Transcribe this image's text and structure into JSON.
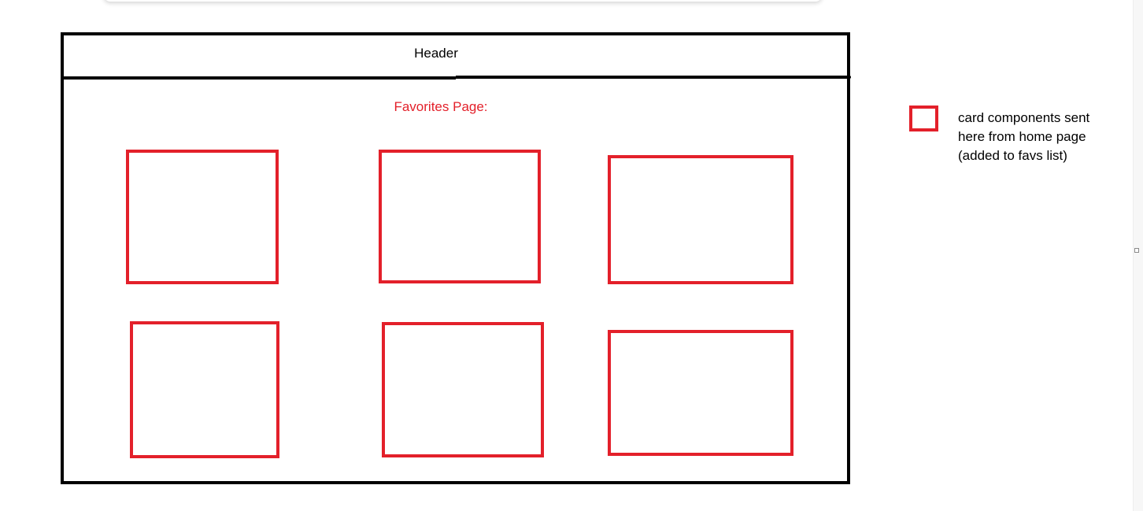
{
  "wireframe": {
    "header_label": "Header",
    "page_label": "Favorites Page:",
    "card_count": 6
  },
  "legend": {
    "lines": [
      "card components sent",
      "here from home page",
      "(added to favs list)"
    ]
  },
  "colors": {
    "outline": "#000000",
    "card_outline": "#e3202a",
    "page_label_text": "#e3202a",
    "background": "#ffffff"
  }
}
